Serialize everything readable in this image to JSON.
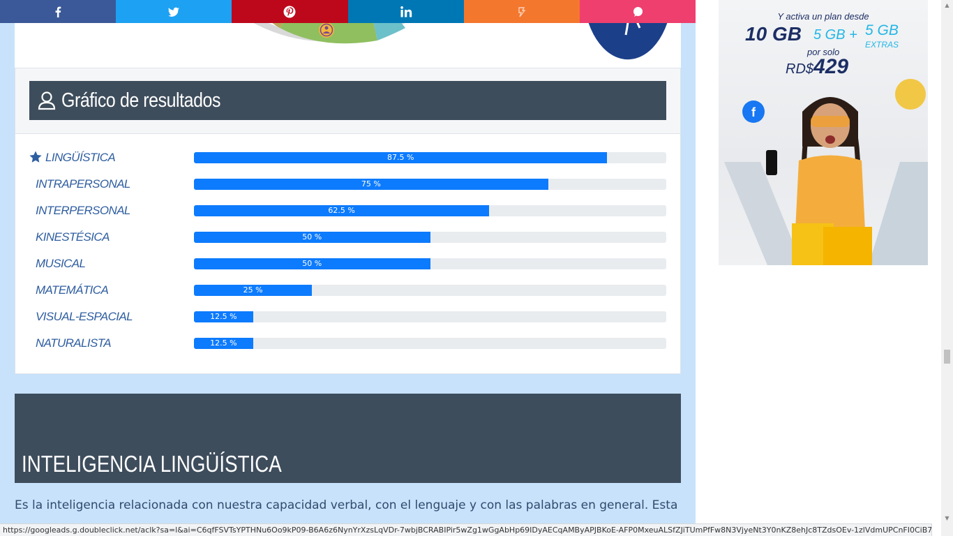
{
  "share_bar": {
    "buttons": [
      {
        "name": "facebook",
        "color": "#3b5998"
      },
      {
        "name": "twitter",
        "color": "#1da1f2"
      },
      {
        "name": "pinterest",
        "color": "#bd081c"
      },
      {
        "name": "linkedin",
        "color": "#0077b5"
      },
      {
        "name": "meneame",
        "color": "#f4772e"
      },
      {
        "name": "comment",
        "color": "#ee3f6e"
      }
    ]
  },
  "results": {
    "title": "Gráfico de resultados",
    "items": [
      {
        "label": "LINGÜÍSTICA",
        "value": 87.5,
        "text": "87.5 %",
        "starred": true
      },
      {
        "label": "INTRAPERSONAL",
        "value": 75,
        "text": "75 %"
      },
      {
        "label": "INTERPERSONAL",
        "value": 62.5,
        "text": "62.5 %"
      },
      {
        "label": "KINESTÉSICA",
        "value": 50,
        "text": "50 %"
      },
      {
        "label": "MUSICAL",
        "value": 50,
        "text": "50 %"
      },
      {
        "label": "MATEMÁTICA",
        "value": 25,
        "text": "25 %"
      },
      {
        "label": "VISUAL-ESPACIAL",
        "value": 12.5,
        "text": "12.5 %"
      },
      {
        "label": "NATURALISTA",
        "value": 12.5,
        "text": "12.5 %"
      }
    ],
    "bar_color": "#0d7bfd",
    "track_color": "#e9ecef"
  },
  "section": {
    "heading": "INTELIGENCIA LINGÜÍSTICA",
    "paragraph": "Es la inteligencia relacionada con nuestra capacidad verbal, con el lenguaje y con las palabras en general. Esta"
  },
  "ad": {
    "line1": "Y activa un plan desde",
    "gb_main": "10 GB",
    "gb_plus": "5 GB +",
    "gb_extra": "5 GB",
    "extras": "EXTRAS",
    "por_solo": "por solo",
    "currency": "RD$",
    "price": "429"
  },
  "status_url": "https://googleads.g.doubleclick.net/aclk?sa=l&ai=C6qfFSVTsYPTHNu6Oo9kP09-B6A6z6NynYrXzsLqVDr-7wbjBCRABIPir5wZg1wGgAbHp69IDyAECqAMByAPJBKoE-AFP0MxeuALSfZJiTUmPfFw8N3VjyeNt3Y0nKZ8ehJc8TZdsOEv-1zlVdmUPCnFI0CiB7QP..."
}
